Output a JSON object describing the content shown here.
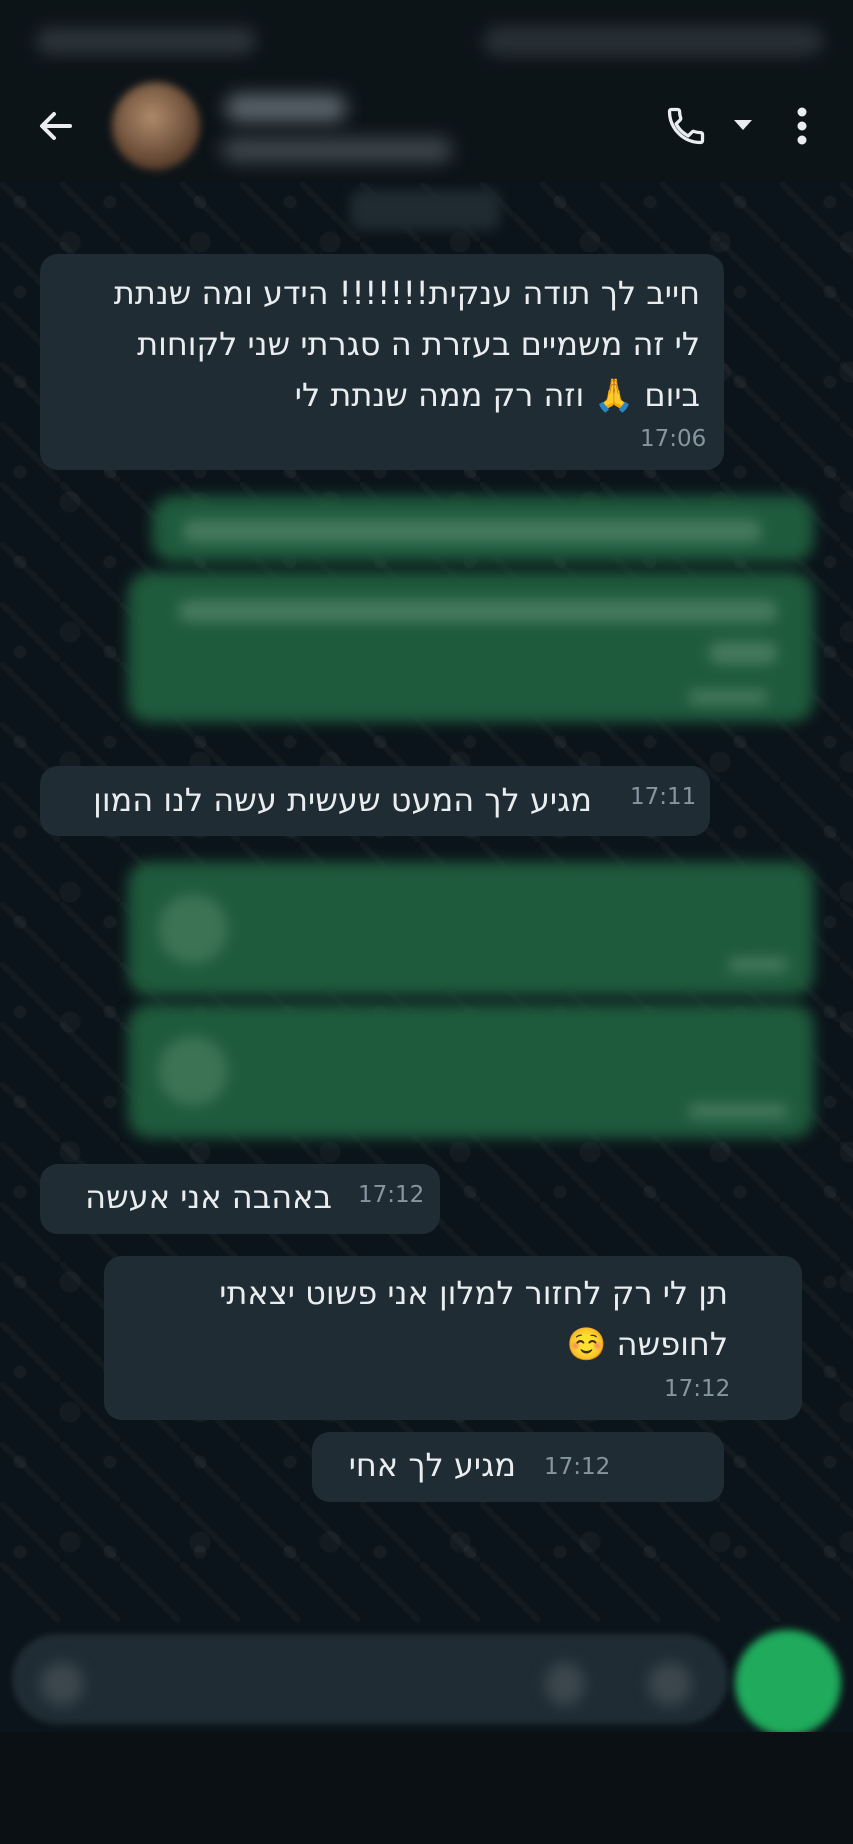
{
  "messages": [
    {
      "direction": "received",
      "lines": [
        "חייב לך תודה ענקית!!!!!!! הידע ומה שנתת",
        "לי זה משמיים בעזרת ה סגרתי שני לקוחות",
        "ביום 🙏 וזה רק ממה שנתת לי"
      ],
      "time": "17:06"
    },
    {
      "direction": "received",
      "lines": [
        "מגיע לך המעט שעשית עשה לנו המון"
      ],
      "time": "17:11"
    },
    {
      "direction": "received",
      "lines": [
        "באהבה אני אעשה"
      ],
      "time": "17:12"
    },
    {
      "direction": "received",
      "lines": [
        "תן לי רק לחזור למלון אני פשוט יצאתי",
        "לחופשה ☺️"
      ],
      "time": "17:12"
    },
    {
      "direction": "received",
      "lines": [
        "מגיע לך אחי"
      ],
      "time": "17:12"
    }
  ],
  "icons": {
    "back": "arrow-left-icon",
    "call": "phone-icon",
    "dropdown": "caret-down-icon",
    "menu": "more-vert-icon"
  },
  "colors": {
    "background": "#0b141a",
    "incoming_bubble": "#202c33",
    "outgoing_bubble": "#1e5a3c",
    "accent": "#1faa5c"
  }
}
